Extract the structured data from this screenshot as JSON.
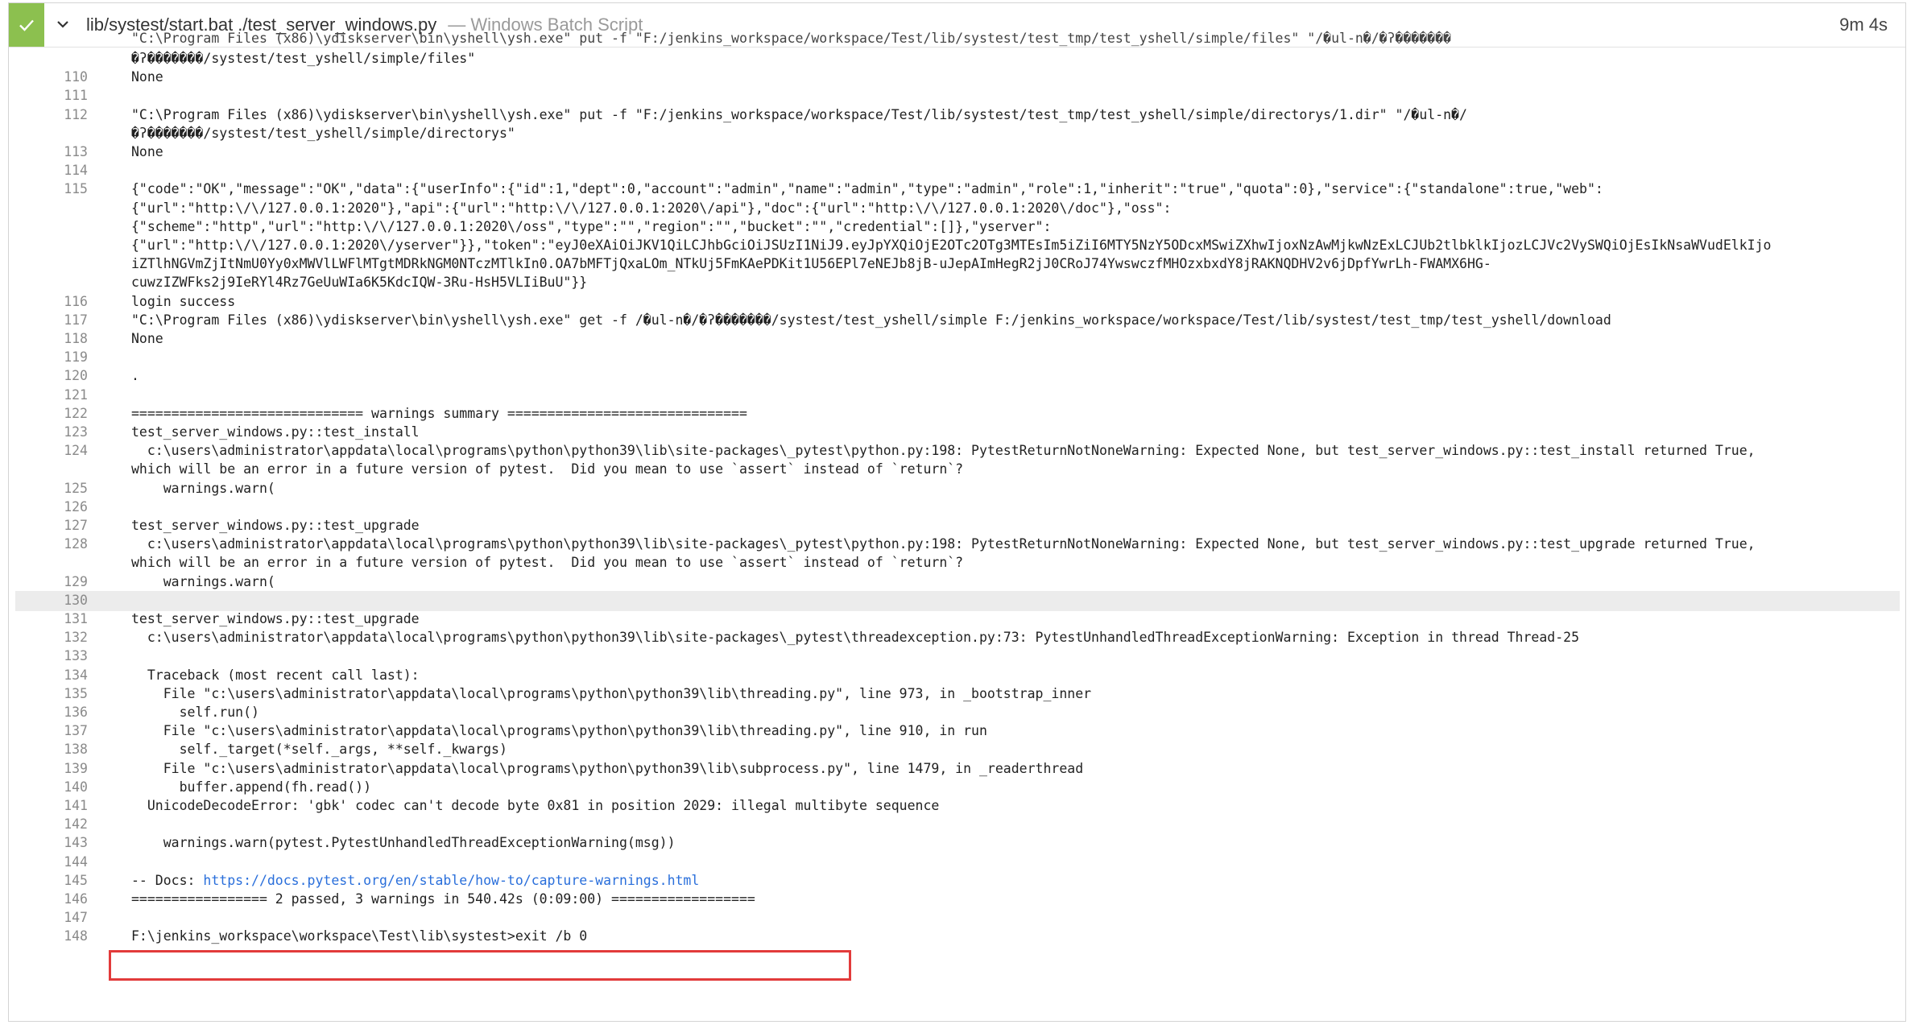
{
  "header": {
    "title": "lib/systest/start.bat ./test_server_windows.py",
    "subtitle": "— Windows Batch Script",
    "duration": "9m 4s"
  },
  "log": {
    "partial_top_line": "\"C:\\Program Files (x86)\\ydiskserver\\bin\\yshell\\ysh.exe\" put -f \"F:/jenkins_workspace/workspace/Test/lib/systest/test_tmp/test_yshell/simple/files\" \"/�ul-n�/�ʔ�������",
    "lines": [
      {
        "n": "",
        "t": "�ʔ�������/systest/test_yshell/simple/files\""
      },
      {
        "n": "110",
        "t": "None"
      },
      {
        "n": "111",
        "t": ""
      },
      {
        "n": "112",
        "t": "\"C:\\Program Files (x86)\\ydiskserver\\bin\\yshell\\ysh.exe\" put -f \"F:/jenkins_workspace/workspace/Test/lib/systest/test_tmp/test_yshell/simple/directorys/1.dir\" \"/�ul-n�/"
      },
      {
        "n": "",
        "t": "�ʔ�������/systest/test_yshell/simple/directorys\""
      },
      {
        "n": "113",
        "t": "None"
      },
      {
        "n": "114",
        "t": ""
      },
      {
        "n": "115",
        "t": "{\"code\":\"OK\",\"message\":\"OK\",\"data\":{\"userInfo\":{\"id\":1,\"dept\":0,\"account\":\"admin\",\"name\":\"admin\",\"type\":\"admin\",\"role\":1,\"inherit\":\"true\",\"quota\":0},\"service\":{\"standalone\":true,\"web\":"
      },
      {
        "n": "",
        "t": "{\"url\":\"http:\\/\\/127.0.0.1:2020\"},\"api\":{\"url\":\"http:\\/\\/127.0.0.1:2020\\/api\"},\"doc\":{\"url\":\"http:\\/\\/127.0.0.1:2020\\/doc\"},\"oss\":"
      },
      {
        "n": "",
        "t": "{\"scheme\":\"http\",\"url\":\"http:\\/\\/127.0.0.1:2020\\/oss\",\"type\":\"\",\"region\":\"\",\"bucket\":\"\",\"credential\":[]},\"yserver\":"
      },
      {
        "n": "",
        "t": "{\"url\":\"http:\\/\\/127.0.0.1:2020\\/yserver\"}},\"token\":\"eyJ0eXAiOiJKV1QiLCJhbGciOiJSUzI1NiJ9.eyJpYXQiOjE2OTc2OTg3MTEsIm5iZiI6MTY5NzY5ODcxMSwiZXhwIjoxNzAwMjkwNzExLCJUb2tlbklkIjozLCJVc2VySWQiOjEsIkNsaWVudElkIjo"
      },
      {
        "n": "",
        "t": "iZTlhNGVmZjItNmU0Yy0xMWVlLWFlMTgtMDRkNGM0NTczMTlkIn0.OA7bMFTjQxaLOm_NTkUj5FmKAePDKit1U56EPl7eNEJb8jB-uJepAImHegR2jJ0CRoJ74YwswczfMHOzxbxdY8jRAKNQDHV2v6jDpfYwrLh-FWAMX6HG-"
      },
      {
        "n": "",
        "t": "cuwzIZWFks2j9IeRYl4Rz7GeUuWIa6K5KdcIQW-3Ru-HsH5VLIiBuU\"}}"
      },
      {
        "n": "116",
        "t": "login success"
      },
      {
        "n": "117",
        "t": "\"C:\\Program Files (x86)\\ydiskserver\\bin\\yshell\\ysh.exe\" get -f /�ul-n�/�ʔ�������/systest/test_yshell/simple F:/jenkins_workspace/workspace/Test/lib/systest/test_tmp/test_yshell/download"
      },
      {
        "n": "118",
        "t": "None"
      },
      {
        "n": "119",
        "t": ""
      },
      {
        "n": "120",
        "t": "."
      },
      {
        "n": "121",
        "t": ""
      },
      {
        "n": "122",
        "t": "============================= warnings summary =============================="
      },
      {
        "n": "123",
        "t": "test_server_windows.py::test_install"
      },
      {
        "n": "124",
        "t": "  c:\\users\\administrator\\appdata\\local\\programs\\python\\python39\\lib\\site-packages\\_pytest\\python.py:198: PytestReturnNotNoneWarning: Expected None, but test_server_windows.py::test_install returned True,"
      },
      {
        "n": "",
        "t": "which will be an error in a future version of pytest.  Did you mean to use `assert` instead of `return`?"
      },
      {
        "n": "125",
        "t": "    warnings.warn("
      },
      {
        "n": "126",
        "t": ""
      },
      {
        "n": "127",
        "t": "test_server_windows.py::test_upgrade"
      },
      {
        "n": "128",
        "t": "  c:\\users\\administrator\\appdata\\local\\programs\\python\\python39\\lib\\site-packages\\_pytest\\python.py:198: PytestReturnNotNoneWarning: Expected None, but test_server_windows.py::test_upgrade returned True,"
      },
      {
        "n": "",
        "t": "which will be an error in a future version of pytest.  Did you mean to use `assert` instead of `return`?"
      },
      {
        "n": "129",
        "t": "    warnings.warn("
      },
      {
        "n": "130",
        "t": ""
      },
      {
        "n": "131",
        "t": "test_server_windows.py::test_upgrade"
      },
      {
        "n": "132",
        "t": "  c:\\users\\administrator\\appdata\\local\\programs\\python\\python39\\lib\\site-packages\\_pytest\\threadexception.py:73: PytestUnhandledThreadExceptionWarning: Exception in thread Thread-25"
      },
      {
        "n": "133",
        "t": ""
      },
      {
        "n": "134",
        "t": "  Traceback (most recent call last):"
      },
      {
        "n": "135",
        "t": "    File \"c:\\users\\administrator\\appdata\\local\\programs\\python\\python39\\lib\\threading.py\", line 973, in _bootstrap_inner"
      },
      {
        "n": "136",
        "t": "      self.run()"
      },
      {
        "n": "137",
        "t": "    File \"c:\\users\\administrator\\appdata\\local\\programs\\python\\python39\\lib\\threading.py\", line 910, in run"
      },
      {
        "n": "138",
        "t": "      self._target(*self._args, **self._kwargs)"
      },
      {
        "n": "139",
        "t": "    File \"c:\\users\\administrator\\appdata\\local\\programs\\python\\python39\\lib\\subprocess.py\", line 1479, in _readerthread"
      },
      {
        "n": "140",
        "t": "      buffer.append(fh.read())"
      },
      {
        "n": "141",
        "t": "  UnicodeDecodeError: 'gbk' codec can't decode byte 0x81 in position 2029: illegal multibyte sequence"
      },
      {
        "n": "142",
        "t": ""
      },
      {
        "n": "143",
        "t": "    warnings.warn(pytest.PytestUnhandledThreadExceptionWarning(msg))"
      },
      {
        "n": "144",
        "t": ""
      },
      {
        "n": "145",
        "t": "-- Docs: ",
        "link": "https://docs.pytest.org/en/stable/how-to/capture-warnings.html"
      },
      {
        "n": "146",
        "t": "================= 2 passed, 3 warnings in 540.42s (0:09:00) =================="
      },
      {
        "n": "147",
        "t": ""
      },
      {
        "n": "148",
        "t": "F:\\jenkins_workspace\\workspace\\Test\\lib\\systest>exit /b 0"
      }
    ]
  },
  "colors": {
    "status_success": "#8cc04f",
    "link": "#2a6fdb",
    "annotation_box": "#e23b3b",
    "highlight_row": "#ececec"
  },
  "icons": {
    "status": "check-icon",
    "expand": "chevron-down-icon"
  }
}
